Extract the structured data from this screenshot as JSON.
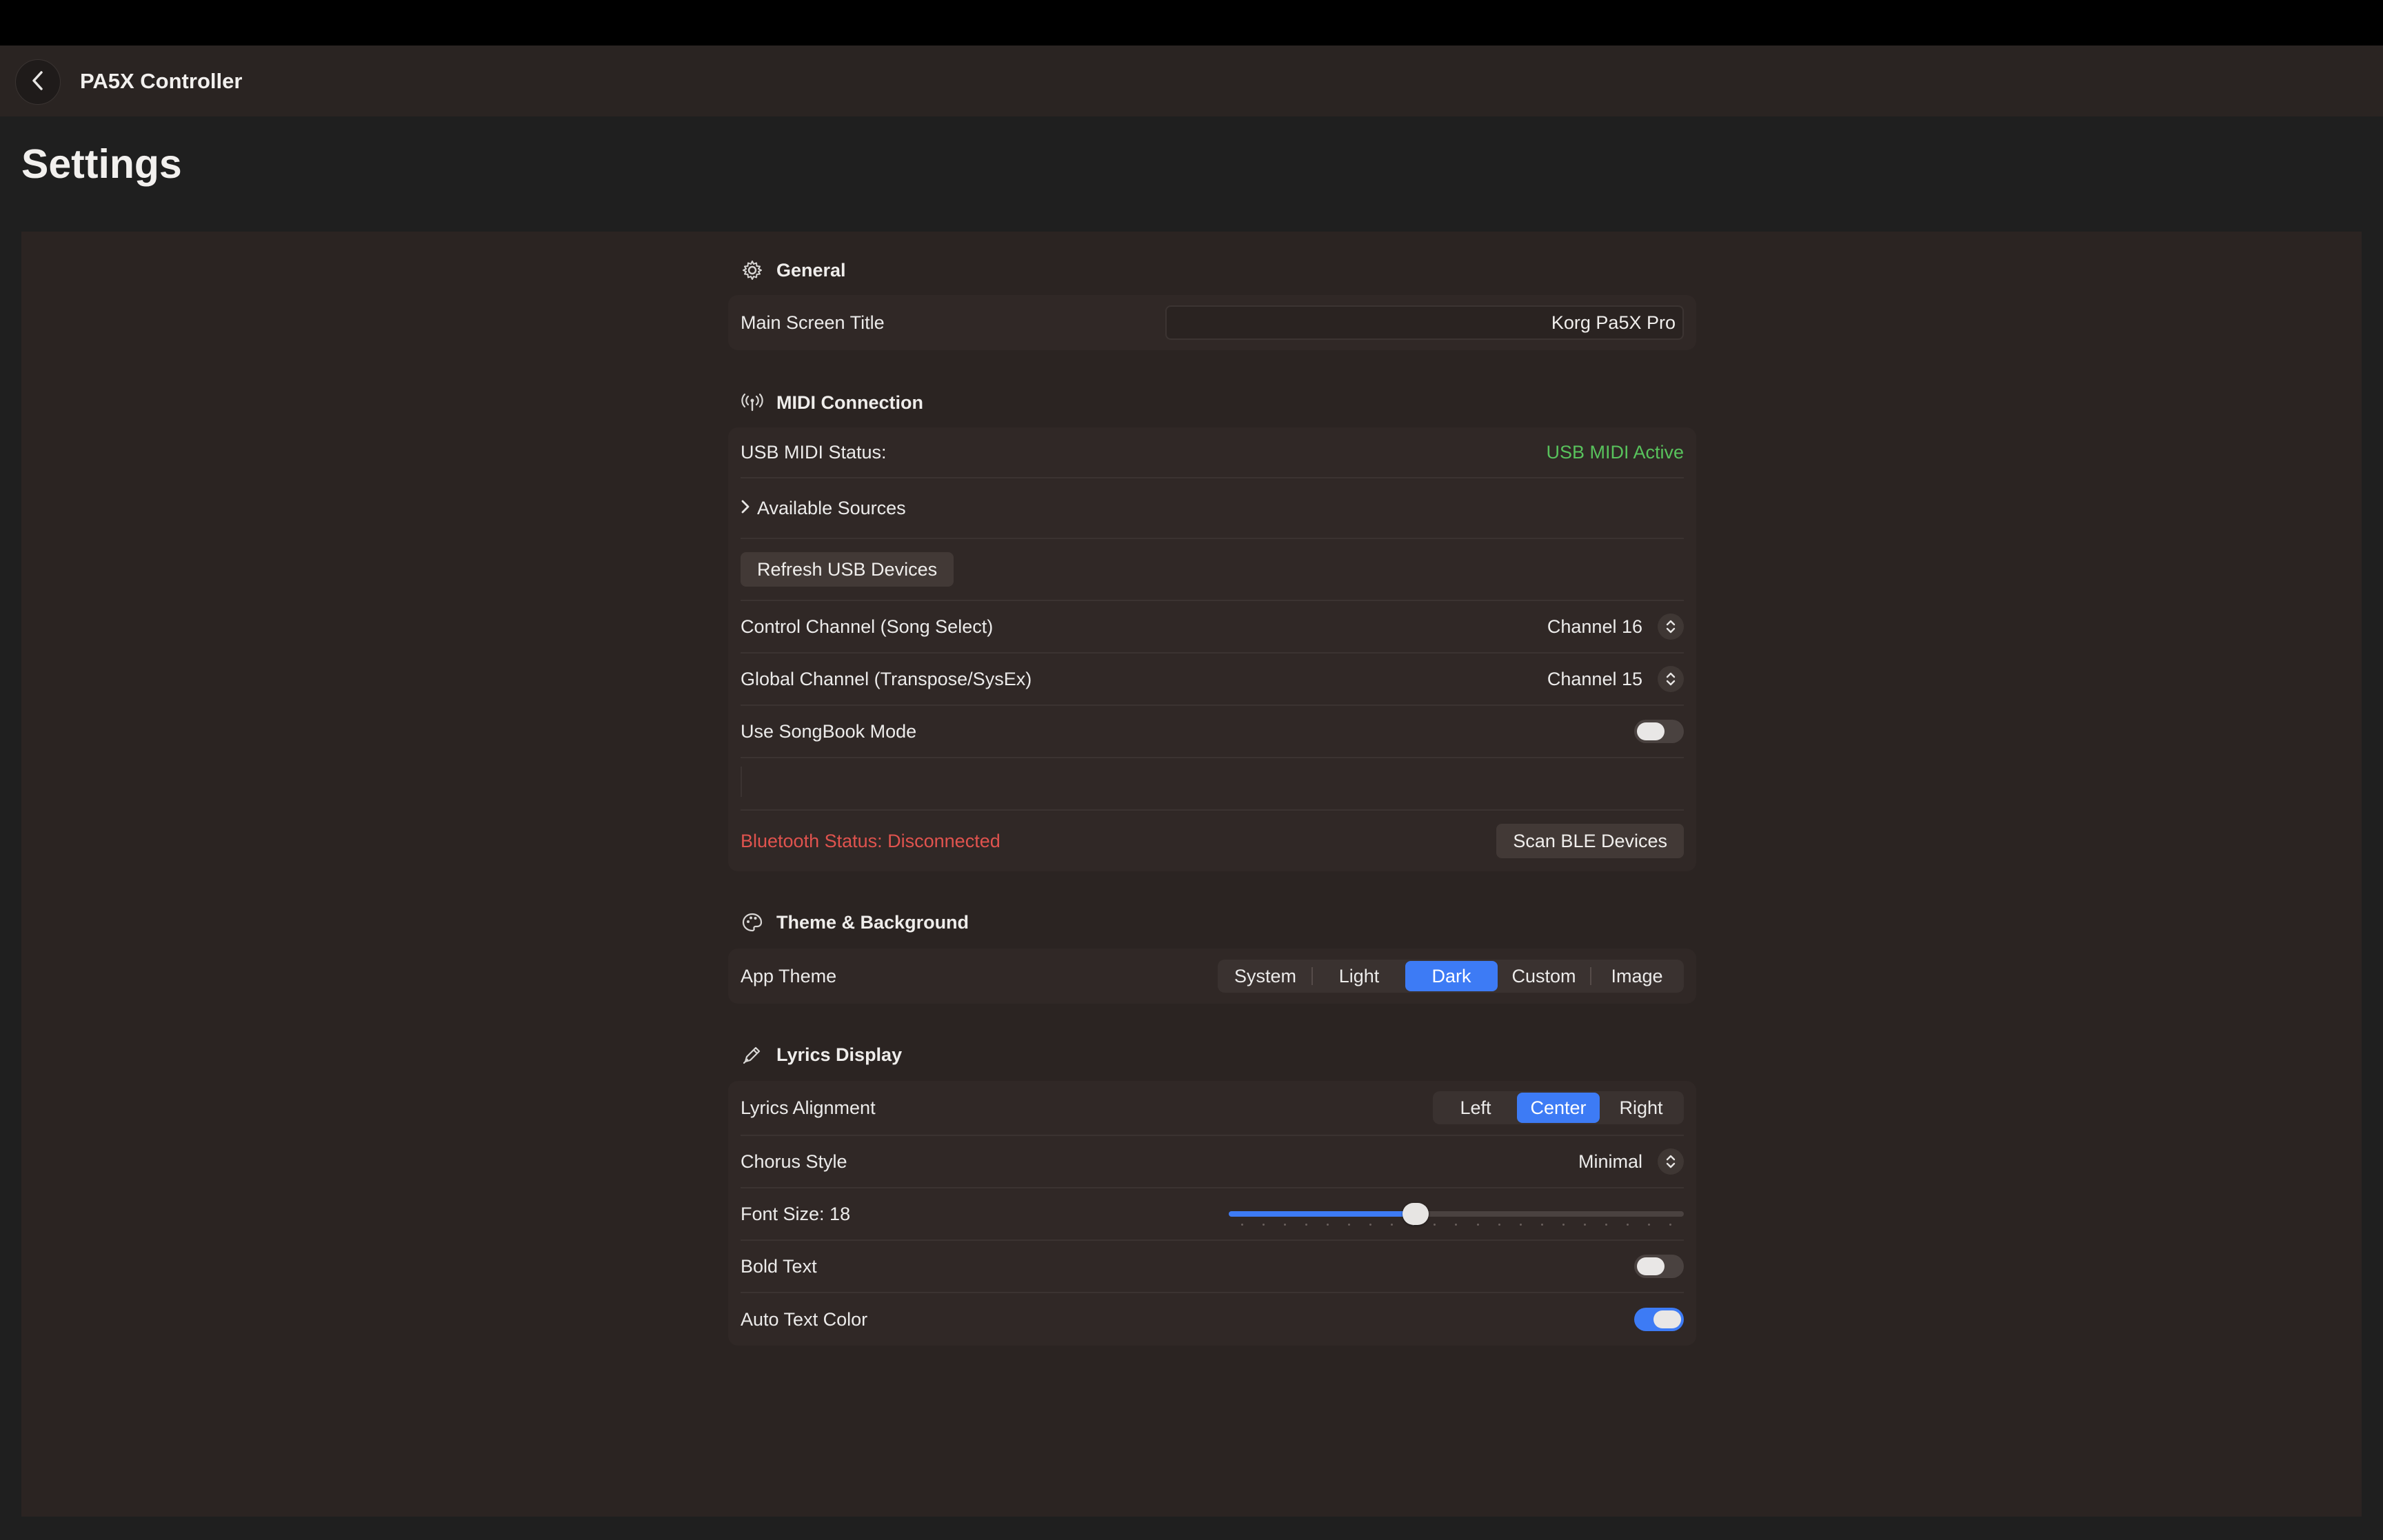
{
  "app": {
    "title": "PA5X Controller",
    "page_title": "Settings"
  },
  "colors": {
    "accent": "#3d7bf5",
    "success": "#58c25c",
    "error": "#e0534e"
  },
  "general": {
    "header": "General",
    "main_screen_title_label": "Main Screen Title",
    "main_screen_title_value": "Korg Pa5X Pro"
  },
  "midi": {
    "header": "MIDI Connection",
    "usb_status_label": "USB MIDI Status:",
    "usb_status_value": "USB MIDI Active",
    "available_sources_label": "Available Sources",
    "refresh_button": "Refresh USB Devices",
    "control_channel_label": "Control Channel (Song Select)",
    "control_channel_value": "Channel 16",
    "global_channel_label": "Global Channel (Transpose/SysEx)",
    "global_channel_value": "Channel 15",
    "songbook_label": "Use SongBook Mode",
    "songbook_on": false,
    "bluetooth_status": "Bluetooth Status: Disconnected",
    "scan_button": "Scan BLE Devices"
  },
  "theme": {
    "header": "Theme & Background",
    "app_theme_label": "App Theme",
    "options": [
      "System",
      "Light",
      "Dark",
      "Custom",
      "Image"
    ],
    "selected": "Dark"
  },
  "lyrics": {
    "header": "Lyrics Display",
    "alignment_label": "Lyrics Alignment",
    "alignment_options": [
      "Left",
      "Center",
      "Right"
    ],
    "alignment_selected": "Center",
    "chorus_style_label": "Chorus Style",
    "chorus_style_value": "Minimal",
    "font_size_label": "Font Size: 18",
    "font_size_fraction": 0.405,
    "bold_text_label": "Bold Text",
    "bold_text_on": false,
    "auto_color_label": "Auto Text Color",
    "auto_color_on": true
  }
}
